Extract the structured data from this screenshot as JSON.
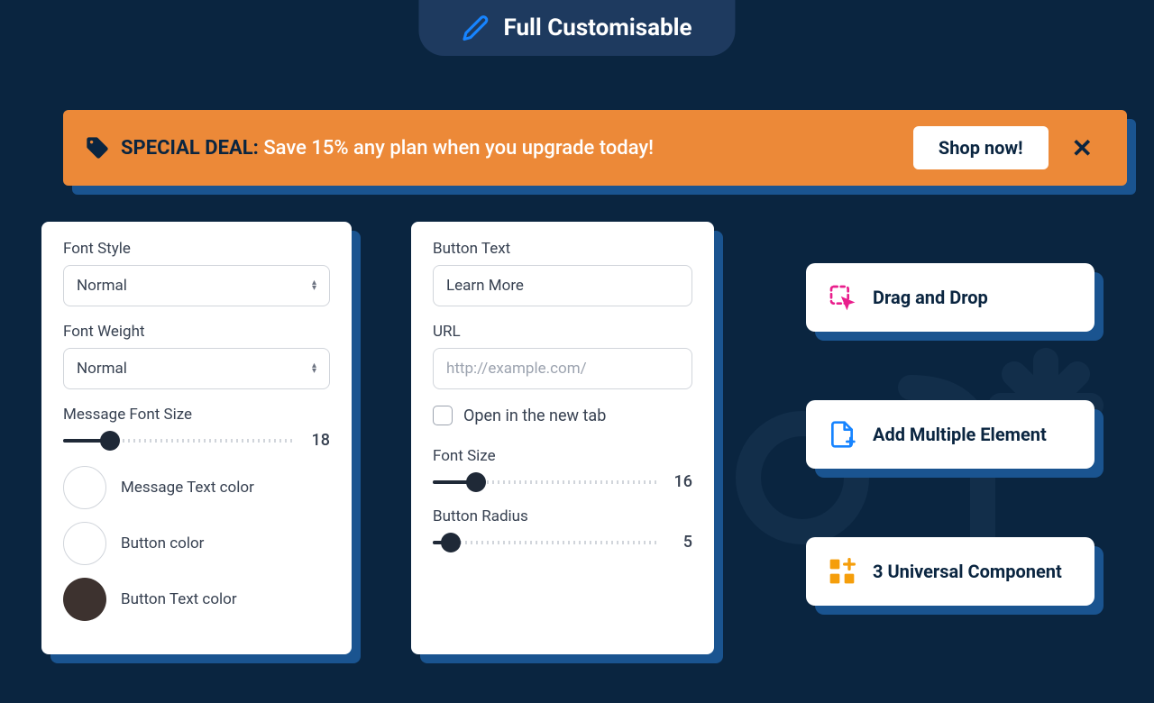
{
  "header": {
    "title": "Full Customisable"
  },
  "banner": {
    "prefix": "SPECIAL DEAL:",
    "message": "Save 15% any plan when you upgrade today!",
    "cta": "Shop now!"
  },
  "panel1": {
    "fontStyle": {
      "label": "Font Style",
      "value": "Normal"
    },
    "fontWeight": {
      "label": "Font Weight",
      "value": "Normal"
    },
    "messageFontSize": {
      "label": "Message Font Size",
      "value": "18"
    },
    "colors": {
      "messageText": "Message Text color",
      "button": "Button color",
      "buttonText": "Button Text color"
    }
  },
  "panel2": {
    "buttonText": {
      "label": "Button Text",
      "value": "Learn More"
    },
    "url": {
      "label": "URL",
      "placeholder": "http://example.com/"
    },
    "newTab": "Open in the new tab",
    "fontSize": {
      "label": "Font Size",
      "value": "16"
    },
    "buttonRadius": {
      "label": "Button Radius",
      "value": "5"
    }
  },
  "features": {
    "f1": "Drag and Drop",
    "f2": "Add Multiple Element",
    "f3": "3 Universal Component"
  }
}
